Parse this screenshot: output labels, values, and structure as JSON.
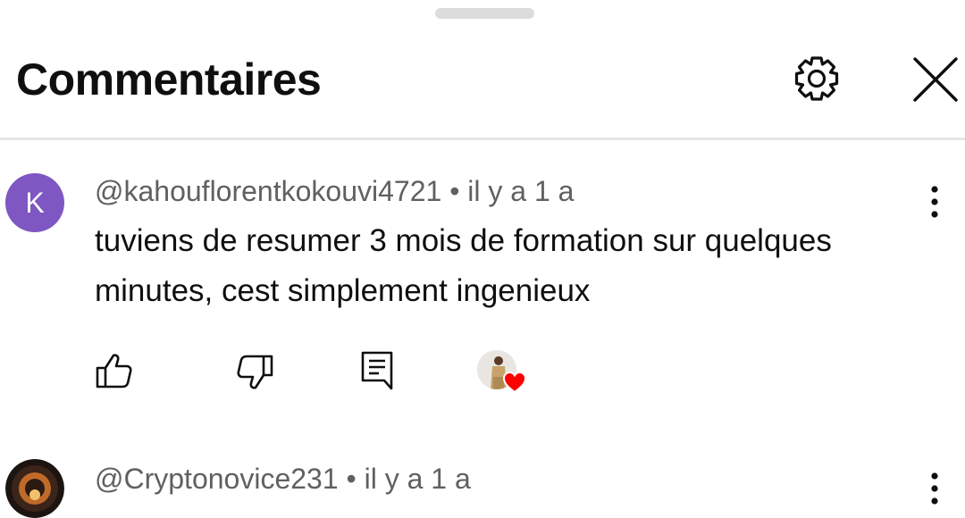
{
  "header": {
    "title": "Commentaires",
    "settings_icon": "gear-icon",
    "close_icon": "close-icon"
  },
  "comments": [
    {
      "avatar_letter": "K",
      "avatar_color": "#7e57c2",
      "meta": "@kahouflorentkokouvi4721 • il y a 1 a",
      "text": "tuviens de resumer 3 mois de formation sur quelques minutes, cest simplement ingenieux",
      "actions": [
        "like-icon",
        "dislike-icon",
        "reply-icon",
        "creator-heart"
      ]
    },
    {
      "avatar_icon": "crypto-avatar",
      "meta": "@Cryptonovice231 • il y a 1 a"
    }
  ],
  "colors": {
    "text": "#0f0f0f",
    "meta": "#606060",
    "heart": "#ff0000",
    "divider": "#e6e6e6"
  }
}
